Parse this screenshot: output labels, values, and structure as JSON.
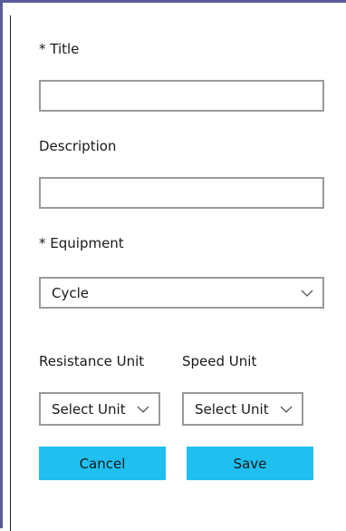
{
  "form": {
    "title_label": "* Title",
    "title_value": "",
    "description_label": "Description",
    "description_value": "",
    "equipment_label": "* Equipment",
    "equipment_selected": "Cycle",
    "resistance_unit_label": "Resistance Unit",
    "resistance_unit_selected": "Select Unit",
    "speed_unit_label": "Speed Unit",
    "speed_unit_selected": "Select Unit"
  },
  "actions": {
    "cancel_label": "Cancel",
    "save_label": "Save"
  },
  "colors": {
    "button_bg": "#1fbff0",
    "frame_border": "#5a5a9c",
    "input_border": "#9a9a9a"
  },
  "icons": {
    "dropdown": "chevron-down-icon"
  }
}
